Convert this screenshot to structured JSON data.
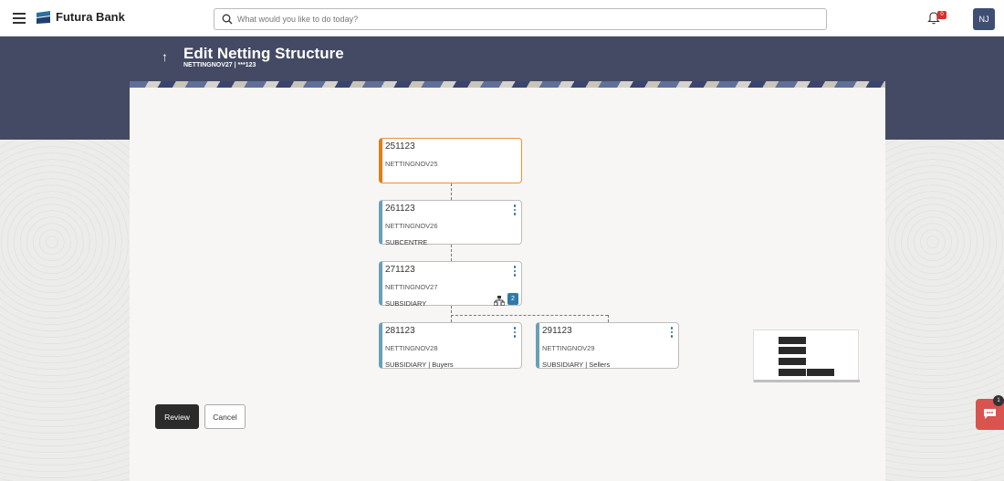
{
  "header": {
    "brand": "Futura Bank",
    "search_placeholder": "What would you like to do today?",
    "notification_count": "0",
    "avatar_initials": "NJ"
  },
  "page": {
    "title": "Edit Netting Structure",
    "subtitle": "NETTINGNOV27 | ***123"
  },
  "structure": {
    "root": {
      "code": "251123",
      "name": "NETTINGNOV25"
    },
    "level1": {
      "code": "261123",
      "name": "NETTINGNOV26",
      "type": "SUBCENTRE"
    },
    "level2": {
      "code": "271123",
      "name": "NETTINGNOV27",
      "type": "SUBSIDIARY",
      "child_count": "2"
    },
    "children": [
      {
        "code": "281123",
        "name": "NETTINGNOV28",
        "type": "SUBSIDIARY | Buyers"
      },
      {
        "code": "291123",
        "name": "NETTINGNOV29",
        "type": "SUBSIDIARY | Sellers"
      }
    ]
  },
  "actions": {
    "review_label": "Review",
    "cancel_label": "Cancel"
  },
  "chat": {
    "badge": "1"
  },
  "colors": {
    "header_band": "#444a63",
    "root_accent": "#e07e1a",
    "node_accent": "#6a9fb8",
    "primary_button": "#2b2b2b",
    "chat_button": "#d9534f"
  }
}
